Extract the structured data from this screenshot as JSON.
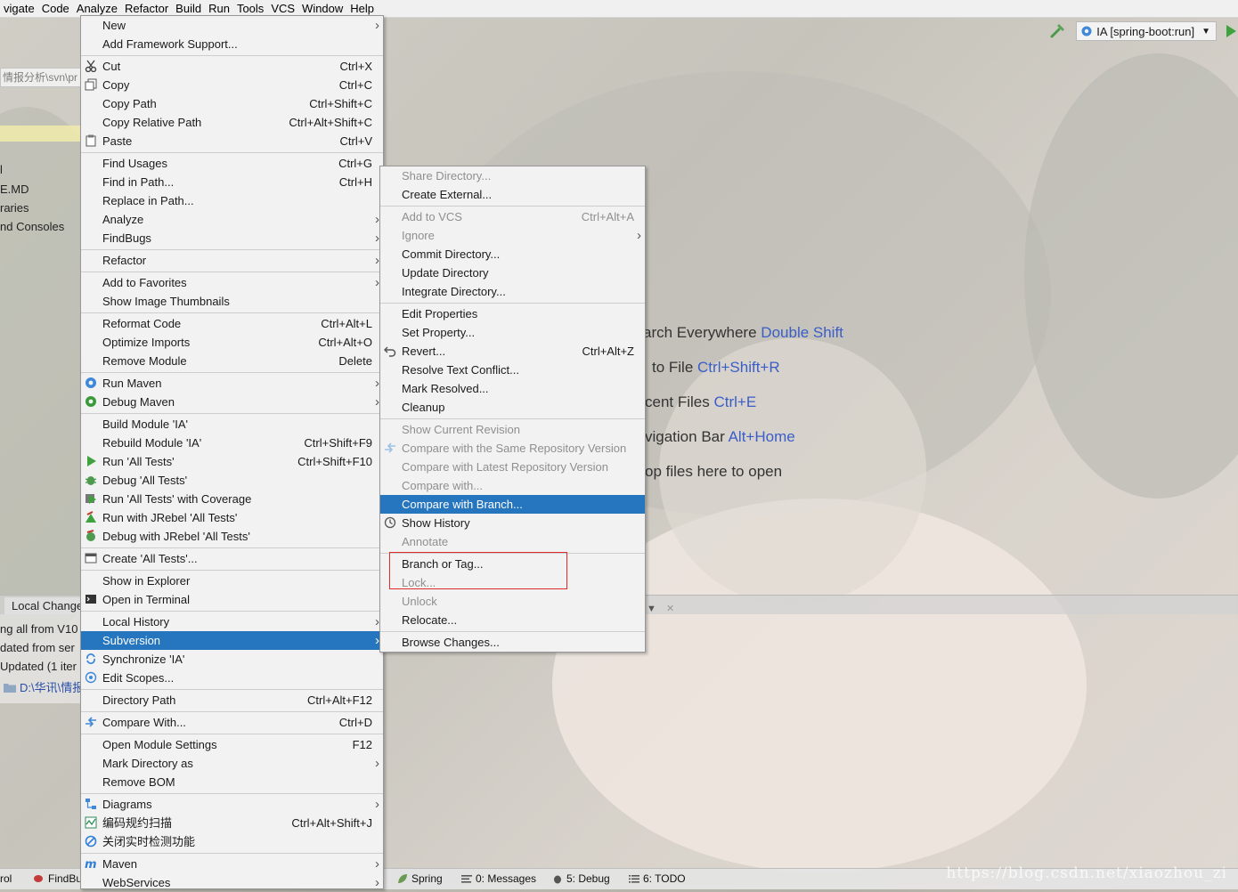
{
  "menubar": [
    "vigate",
    "Code",
    "Analyze",
    "Refactor",
    "Build",
    "Run",
    "Tools",
    "VCS",
    "Window",
    "Help"
  ],
  "toolbar": {
    "run_config": "IA [spring-boot:run]"
  },
  "left_panel": {
    "path": "情报分析\\svn\\pr",
    "tree_items": [
      "l",
      "E.MD",
      "raries",
      "nd Consoles"
    ],
    "local_changes_tab": "Local Change",
    "log_lines": [
      "ng all from V10",
      "dated from ser",
      "Updated (1 iter"
    ],
    "log_path": "D:\\华讯\\情报"
  },
  "welcome_hints": [
    {
      "text": "arch Everywhere",
      "key": "Double Shift"
    },
    {
      "text": "to File",
      "key": "Ctrl+Shift+R"
    },
    {
      "text": "cent Files",
      "key": "Ctrl+E"
    },
    {
      "text": "vigation Bar",
      "key": "Alt+Home"
    },
    {
      "text": "op files here to open",
      "key": ""
    }
  ],
  "main_menu": [
    {
      "label": "New",
      "sub": true
    },
    {
      "label": "Add Framework Support..."
    },
    {
      "sep": true
    },
    {
      "label": "Cut",
      "shortcut": "Ctrl+X",
      "icon": "scissors-icon"
    },
    {
      "label": "Copy",
      "shortcut": "Ctrl+C",
      "icon": "copy-icon"
    },
    {
      "label": "Copy Path",
      "shortcut": "Ctrl+Shift+C"
    },
    {
      "label": "Copy Relative Path",
      "shortcut": "Ctrl+Alt+Shift+C"
    },
    {
      "label": "Paste",
      "shortcut": "Ctrl+V",
      "icon": "paste-icon"
    },
    {
      "sep": true
    },
    {
      "label": "Find Usages",
      "shortcut": "Ctrl+G"
    },
    {
      "label": "Find in Path...",
      "shortcut": "Ctrl+H"
    },
    {
      "label": "Replace in Path..."
    },
    {
      "label": "Analyze",
      "sub": true
    },
    {
      "label": "FindBugs",
      "sub": true
    },
    {
      "sep": true
    },
    {
      "label": "Refactor",
      "sub": true
    },
    {
      "sep": true
    },
    {
      "label": "Add to Favorites",
      "sub": true
    },
    {
      "label": "Show Image Thumbnails"
    },
    {
      "sep": true
    },
    {
      "label": "Reformat Code",
      "shortcut": "Ctrl+Alt+L"
    },
    {
      "label": "Optimize Imports",
      "shortcut": "Ctrl+Alt+O"
    },
    {
      "label": "Remove Module",
      "shortcut": "Delete"
    },
    {
      "sep": true
    },
    {
      "label": "Run Maven",
      "sub": true,
      "icon": "maven-run-gear-icon"
    },
    {
      "label": "Debug Maven",
      "sub": true,
      "icon": "maven-debug-gear-icon"
    },
    {
      "sep": true
    },
    {
      "label": "Build Module 'IA'"
    },
    {
      "label": "Rebuild Module 'IA'",
      "shortcut": "Ctrl+Shift+F9"
    },
    {
      "label": "Run 'All Tests'",
      "shortcut": "Ctrl+Shift+F10",
      "icon": "run-triangle-icon"
    },
    {
      "label": "Debug 'All Tests'",
      "icon": "debug-bug-icon"
    },
    {
      "label": "Run 'All Tests' with Coverage",
      "icon": "coverage-icon"
    },
    {
      "label": "Run with JRebel 'All Tests'",
      "icon": "jrebel-run-icon"
    },
    {
      "label": "Debug with JRebel 'All Tests'",
      "icon": "jrebel-debug-icon"
    },
    {
      "sep": true
    },
    {
      "label": "Create 'All Tests'...",
      "icon": "create-config-icon"
    },
    {
      "sep": true
    },
    {
      "label": "Show in Explorer"
    },
    {
      "label": "Open in Terminal",
      "icon": "terminal-icon"
    },
    {
      "sep": true
    },
    {
      "label": "Local History",
      "sub": true
    },
    {
      "label": "Subversion",
      "sub": true,
      "selected": true
    },
    {
      "label": "Synchronize 'IA'",
      "icon": "sync-icon"
    },
    {
      "label": "Edit Scopes...",
      "icon": "scope-icon"
    },
    {
      "sep": true
    },
    {
      "label": "Directory Path",
      "shortcut": "Ctrl+Alt+F12"
    },
    {
      "sep": true
    },
    {
      "label": "Compare With...",
      "shortcut": "Ctrl+D",
      "icon": "compare-arrows-icon"
    },
    {
      "sep": true
    },
    {
      "label": "Open Module Settings",
      "shortcut": "F12"
    },
    {
      "label": "Mark Directory as",
      "sub": true
    },
    {
      "label": "Remove BOM"
    },
    {
      "sep": true
    },
    {
      "label": "Diagrams",
      "sub": true,
      "icon": "diagram-icon"
    },
    {
      "label": "编码规约扫描",
      "shortcut": "Ctrl+Alt+Shift+J",
      "icon": "code-scan-icon"
    },
    {
      "label": "关闭实时检测功能",
      "icon": "disable-circle-icon"
    },
    {
      "sep": true
    },
    {
      "label": "Maven",
      "sub": true,
      "icon": "maven-m-icon"
    },
    {
      "label": "WebServices",
      "sub": true
    }
  ],
  "svn_menu": [
    {
      "label": "Share Directory...",
      "disabled": true
    },
    {
      "label": "Create External..."
    },
    {
      "sep": true
    },
    {
      "label": "Add to VCS",
      "shortcut": "Ctrl+Alt+A",
      "disabled": true
    },
    {
      "label": "Ignore",
      "sub": true,
      "disabled": true
    },
    {
      "label": "Commit Directory..."
    },
    {
      "label": "Update Directory"
    },
    {
      "label": "Integrate Directory..."
    },
    {
      "sep": true
    },
    {
      "label": "Edit Properties"
    },
    {
      "label": "Set Property..."
    },
    {
      "label": "Revert...",
      "shortcut": "Ctrl+Alt+Z",
      "icon": "revert-icon"
    },
    {
      "label": "Resolve Text Conflict..."
    },
    {
      "label": "Mark Resolved..."
    },
    {
      "label": "Cleanup"
    },
    {
      "sep": true
    },
    {
      "label": "Show Current Revision",
      "disabled": true
    },
    {
      "label": "Compare with the Same Repository Version",
      "disabled": true,
      "icon": "compare-arrows-icon"
    },
    {
      "label": "Compare with Latest Repository Version",
      "disabled": true
    },
    {
      "label": "Compare with...",
      "disabled": true
    },
    {
      "label": "Compare with Branch...",
      "selected": true
    },
    {
      "label": "Show History",
      "icon": "history-clock-icon"
    },
    {
      "label": "Annotate",
      "disabled": true
    },
    {
      "sep": true
    },
    {
      "label": "Branch or Tag..."
    },
    {
      "label": "Lock...",
      "disabled": true
    },
    {
      "label": "Unlock",
      "disabled": true
    },
    {
      "label": "Relocate..."
    },
    {
      "sep": true
    },
    {
      "label": "Browse Changes..."
    }
  ],
  "statusbar": {
    "items": [
      "rol",
      "FindBu",
      "Spring",
      "0: Messages",
      "5: Debug",
      "6: TODO"
    ],
    "watermark": "https://blog.csdn.net/xiaozhou_zi"
  },
  "colors": {
    "selection": "#2675bf",
    "annotation_box": "#e12a2a",
    "shortcut_link": "#3a5dc8"
  }
}
